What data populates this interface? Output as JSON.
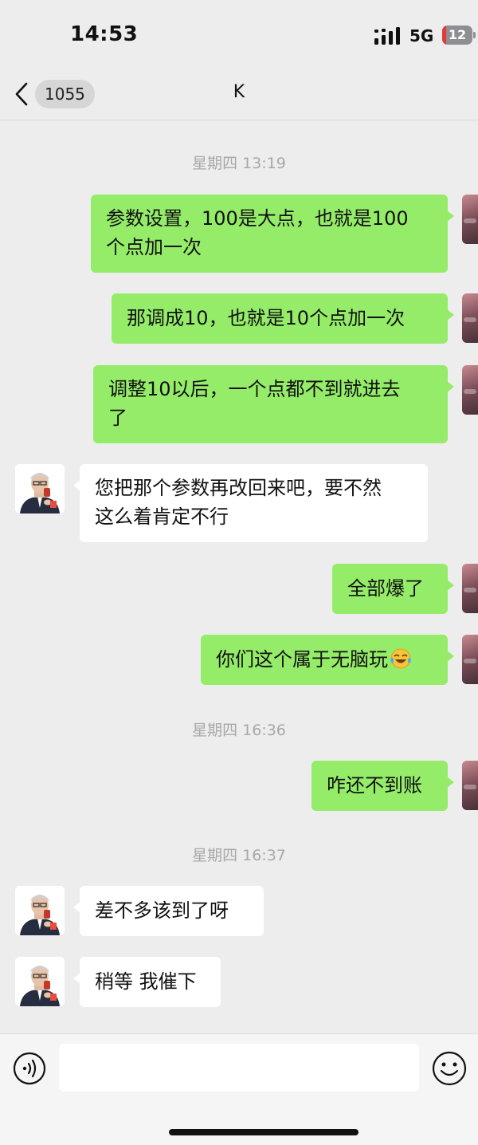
{
  "status_bar": {
    "time": "14:53",
    "network": "5G",
    "battery": "12",
    "battery_level": 0.12,
    "battery_color": "#e53935"
  },
  "nav": {
    "back_icon": "chevron-left-icon",
    "unread_count": "1055",
    "title": "K"
  },
  "timestamps": [
    "星期四 13:19",
    "星期四 16:36",
    "星期四 16:37"
  ],
  "messages": [
    {
      "from": "self",
      "lines": [
        "参数设置，100是大点，也就是100",
        "个点加一次"
      ]
    },
    {
      "from": "self",
      "lines": [
        "那调成10，也就是10个点加一次"
      ]
    },
    {
      "from": "self",
      "lines": [
        "调整10以后，一个点都不到就进去",
        "了"
      ]
    },
    {
      "from": "other",
      "lines": [
        "您把那个参数再改回来吧，要不然",
        "这么着肯定不行"
      ]
    },
    {
      "from": "self",
      "lines": [
        "全部爆了"
      ]
    },
    {
      "from": "self",
      "lines": [
        "你们这个属于无脑玩"
      ],
      "emoji": "crying-laughing-face-icon"
    },
    {
      "from": "self",
      "lines": [
        "咋还不到账"
      ]
    },
    {
      "from": "other",
      "lines": [
        "差不多该到了呀"
      ]
    },
    {
      "from": "other",
      "lines": [
        "稍等 我催下"
      ]
    }
  ],
  "input_bar": {
    "voice_icon": "voice-icon",
    "input_value": "",
    "emoji_icon": "emoji-icon"
  },
  "colors": {
    "background": "#ededed",
    "outgoing_bubble": "#95ec69",
    "incoming_bubble": "#ffffff",
    "timestamp_text": "#a8a8a8"
  }
}
